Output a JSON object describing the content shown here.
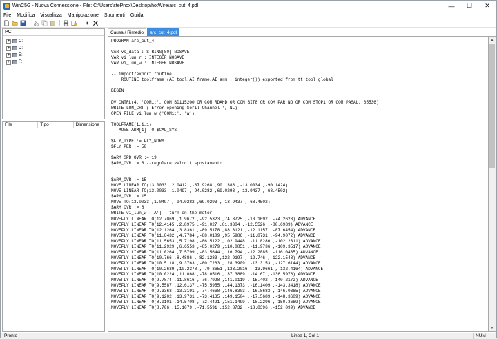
{
  "window": {
    "title": "WinC5G - Nuova Connessione - File: C:\\Users\\stePnox\\Desktop\\hotWire\\arc_cut_4.pdl",
    "controls": {
      "minimize": "—",
      "maximize": "☐",
      "close": "✕"
    }
  },
  "menu": [
    "File",
    "Modifica",
    "Visualizza",
    "Manipolazione",
    "Strumenti",
    "Guida"
  ],
  "toolbar": {
    "icons": [
      "new-file-icon",
      "open-folder-icon",
      "save-icon",
      "cut-icon",
      "copy-icon",
      "paste-icon",
      "print-icon",
      "compile-icon",
      "connect-icon",
      "close-icon"
    ]
  },
  "explorer": {
    "header": "PC",
    "drives": [
      {
        "expand": "+",
        "label": "C:"
      },
      {
        "expand": "+",
        "label": "D:"
      },
      {
        "expand": "+",
        "label": "E:"
      },
      {
        "expand": "+",
        "label": "F:"
      }
    ]
  },
  "file_list": {
    "columns": [
      "File",
      "Tipo",
      "Dimensione"
    ]
  },
  "editor": {
    "tabs": [
      {
        "label": "Causa / Rimedio",
        "active": false
      },
      {
        "label": "arc_cut_4.pdl",
        "active": true
      }
    ],
    "lines": [
      "PROGRAM arc_cut_4",
      "",
      "VAR vs_data : STRING[80] NOSAVE",
      "VAR vi_lun_r : INTEGER NOSAVE",
      "VAR vi_lun_w : INTEGER NOSAVE",
      "",
      "-- import/export routine",
      "    ROUTINE toolframe (AI_tool,AI_frame,AI_arm : integer()) exported from tt_tool global",
      "",
      "BEGIN",
      "",
      "DV_CNTRL(4, 'COM1:', COM_BD115200 OR COM_RDAHD OR COM_BIT8 OR COM_PAR_NO OR COM_STOP1 OR COM_PASAL, 65536)",
      "WRITE LUN_CRT ('Error opening Seril Channel ', NL)",
      "OPEN FILE vi_lun_w ('COM1:', 'w')",
      "",
      "TOOLFRAME(1,1,1)",
      "-- MOVE ARM[1] TO $CAL_SYS",
      "",
      "$FLY_TYPE := FLY_NORM",
      "$FLY_PER := 50",
      "",
      "$ARM_SPD_OVR := 19",
      "$ARM_OVR := 8 --regolare velocit spostamento",
      "",
      "",
      "$ARM_OVR := 15",
      "MOVE LINEAR TO(13.0033 ,2.0412 ,-87.9268 ,90.1388 ,-13.0034 ,-90.1424)",
      "MOVE LINEAR TO(13.0033 ,1.0497 ,-94.0282 ,69.0293 ,-13.9437 ,-68.4502)",
      "$ARM_OVR := 15",
      "MOVE TO(13.0033 ,1.0497 ,-94.0282 ,69.0293 ,-13.9437 ,-68.4502)",
      "$ARM_OVR := 8",
      "WRITE vi_lun_w ('A') --turn on the motor",
      "MOVEFLY LINEAR TO(12.7069 ,1.9672 ,-92.5323 ,74.8725 ,-13.1692 ,-74.2623) ADVANCE",
      "MOVEFLY LINEAR TO(12.4145 ,2.8975 ,-91.027 ,81.3384 ,-12.5526 ,-80.6989) ADVANCE",
      "MOVEFLY LINEAR TO(12.1264 ,3.8361 ,-89.5178 ,88.3121 ,-12.1157 ,-87.6454) ADVANCE",
      "MOVEFLY LINEAR TO(11.8432 ,4.7784 ,-88.0109 ,95.5986 ,-11.8731 ,-94.9072) ADVANCE",
      "MOVEFLY LINEAR TO(11.5653 ,5.7198 ,-86.5122 ,102.9448 ,-11.8286 ,-102.2311) ADVANCE",
      "MOVEFLY LINEAR TO(11.2929 ,6.6553 ,-85.0279 ,110.0851 ,-11.9736 ,-109.3517) ADVANCE",
      "MOVEFLY LINEAR TO(11.0264 ,7.5799 ,-83.5644 ,116.794 ,-12.2885 ,-116.0435) ADVANCE",
      "MOVEFLY LINEAR TO(10.766 ,8.4886 ,-82.1283 ,122.9197 ,-12.746 ,-122.1548) ADVANCE",
      "MOVEFLY LINEAR TO(10.5118 ,9.3763 ,-80.7263 ,128.3909 ,-13.3153 ,-127.6144) ADVANCE",
      "MOVEFLY LINEAR TO(10.2639 ,10.2378 ,-79.3651 ,133.2016 ,-13.9661 ,-132.4164) ADVANCE",
      "MOVEFLY LINEAR TO(10.0224 ,11.068 ,-78.0516 ,137.3889 ,-14.67 ,-136.5976) ADVANCE",
      "MOVEFLY LINEAR TO(9.7874 ,11.8616 ,-76.7928 ,141.0119 ,-15.402 ,-140.2172) ADVANCE",
      "MOVEFLY LINEAR TO(9.5587 ,12.6137 ,-75.5955 ,144.1373 ,-16.1409 ,-143.3418) ADVANCE",
      "MOVEFLY LINEAR TO(9.3363 ,13.3191 ,-74.4668 ,146.8303 ,-16.8683 ,-146.0365) ADVANCE",
      "MOVEFLY LINEAR TO(9.1202 ,13.9731 ,-73.4135 ,149.1504 ,-17.5689 ,-148.3609) ADVANCE",
      "MOVEFLY LINEAR TO(8.9101 ,14.5708 ,-72.4421 ,151.1499 ,-18.2296 ,-150.3669) ADVANCE",
      "MOVEFLY LINEAR TO(8.706 ,15.1079 ,-71.5591 ,152.8732 ,-18.8396 ,-152.099) ADVANCE"
    ]
  },
  "statusbar": {
    "state": "Pronto",
    "position": "Linea 1, Col 1",
    "numlock": "NUM"
  }
}
